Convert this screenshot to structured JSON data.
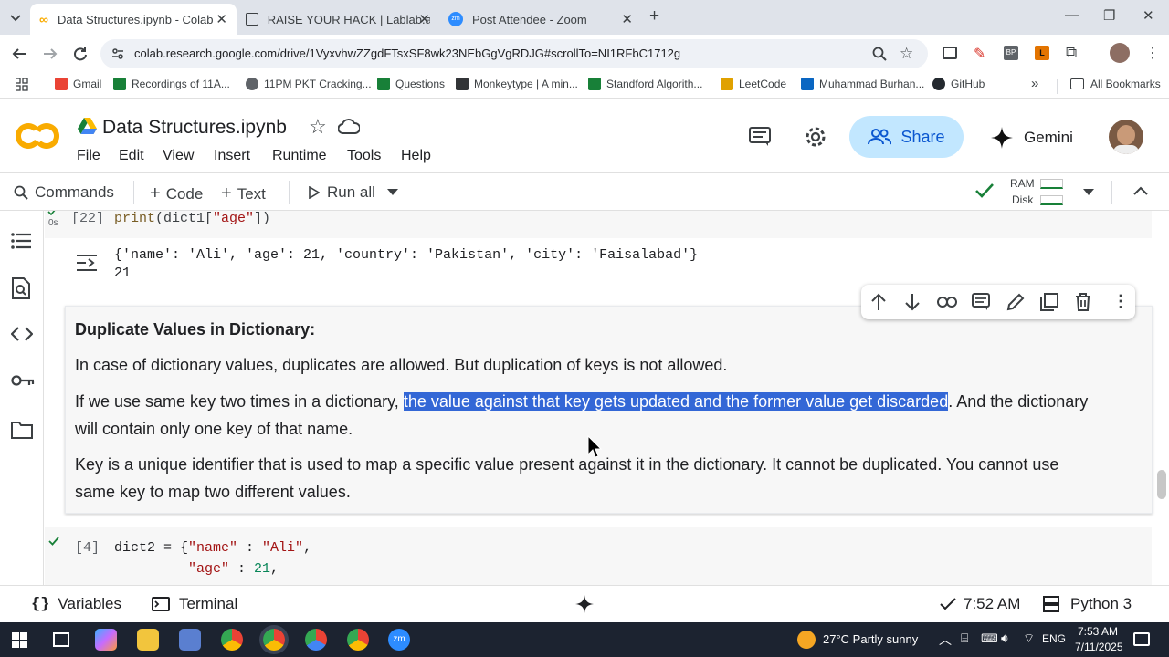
{
  "browser": {
    "tabs": [
      {
        "title": "Data Structures.ipynb - Colab",
        "active": true
      },
      {
        "title": "RAISE YOUR HACK | Lablab.ai",
        "active": false
      },
      {
        "title": "Post Attendee - Zoom",
        "active": false
      }
    ],
    "new_tab": "+",
    "url": "colab.research.google.com/drive/1VyxvhwZZgdFTsxSF8wk23NEbGgVgRDJG#scrollTo=NI1RFbC1712g",
    "bookmarks": [
      {
        "label": "Gmail",
        "icon": "gmail-icon",
        "color": "#ea4335"
      },
      {
        "label": "Recordings of 11A...",
        "icon": "sheets-icon",
        "color": "#188038"
      },
      {
        "label": "11PM PKT Cracking...",
        "icon": "globe-icon",
        "color": "#5f6368"
      },
      {
        "label": "Questions",
        "icon": "sheets-icon",
        "color": "#188038"
      },
      {
        "label": "Monkeytype | A min...",
        "icon": "monkeytype-icon",
        "color": "#323437"
      },
      {
        "label": "Standford Algorith...",
        "icon": "sheets-icon",
        "color": "#188038"
      },
      {
        "label": "LeetCode",
        "icon": "leetcode-icon",
        "color": "#e0a100"
      },
      {
        "label": "Muhammad Burhan...",
        "icon": "linkedin-icon",
        "color": "#0a66c2"
      },
      {
        "label": "GitHub",
        "icon": "github-icon",
        "color": "#24292f"
      }
    ],
    "more_bookmarks": "»",
    "all_bookmarks": "All Bookmarks"
  },
  "colab": {
    "title": "Data Structures.ipynb",
    "menu": [
      "File",
      "Edit",
      "View",
      "Insert",
      "Runtime",
      "Tools",
      "Help"
    ],
    "share": "Share",
    "gemini": "Gemini",
    "toolbar": {
      "commands": "Commands",
      "code": "Code",
      "text": "Text",
      "run_all": "Run all",
      "ram": "RAM",
      "disk": "Disk"
    }
  },
  "cells": {
    "cell22": {
      "exec_time": "0s",
      "prompt": "[22]",
      "code_fn": "print",
      "code_open": "(dict1[",
      "code_str": "\"age\"",
      "code_close": "])",
      "output_line1": "{'name': 'Ali', 'age': 21, 'country': 'Pakistan', 'city': 'Faisalabad'}",
      "output_line2": "21"
    },
    "text_cell": {
      "heading": "Duplicate Values in Dictionary:",
      "p1": "In case of dictionary values, duplicates are allowed. But duplication of keys is not allowed.",
      "p2_before": "If we use same key two times in a dictionary, ",
      "p2_highlight": "the value against that key gets updated and the former value get discarded",
      "p2_after1": ". And the dictionary",
      "p2_line2": "will contain only one key of that name.",
      "p3_line1": "Key is a unique identifier that is used to map a specific value present against it in the dictionary. It cannot be duplicated. You cannot use",
      "p3_line2": "same key to map two different values."
    },
    "cell4": {
      "prompt": "[4]",
      "line1_var": "dict2 = {",
      "line1_key": "\"name\"",
      "line1_sep": " : ",
      "line1_val": "\"Ali\"",
      "line1_end": ",",
      "line2_key": "\"age\"",
      "line2_sep": " : ",
      "line2_val": "21",
      "line2_end": ","
    }
  },
  "statusbar": {
    "variables": "Variables",
    "terminal": "Terminal",
    "time": "7:52 AM",
    "runtime": "Python 3"
  },
  "taskbar": {
    "weather_temp": "27°C",
    "weather_desc": "Partly sunny",
    "lang": "ENG",
    "time": "7:53 AM",
    "date": "7/11/2025"
  },
  "colors": {
    "share_bg": "#c2e7ff",
    "highlight": "#3367d6",
    "colab_orange": "#f9ab00",
    "check_green": "#188038"
  }
}
